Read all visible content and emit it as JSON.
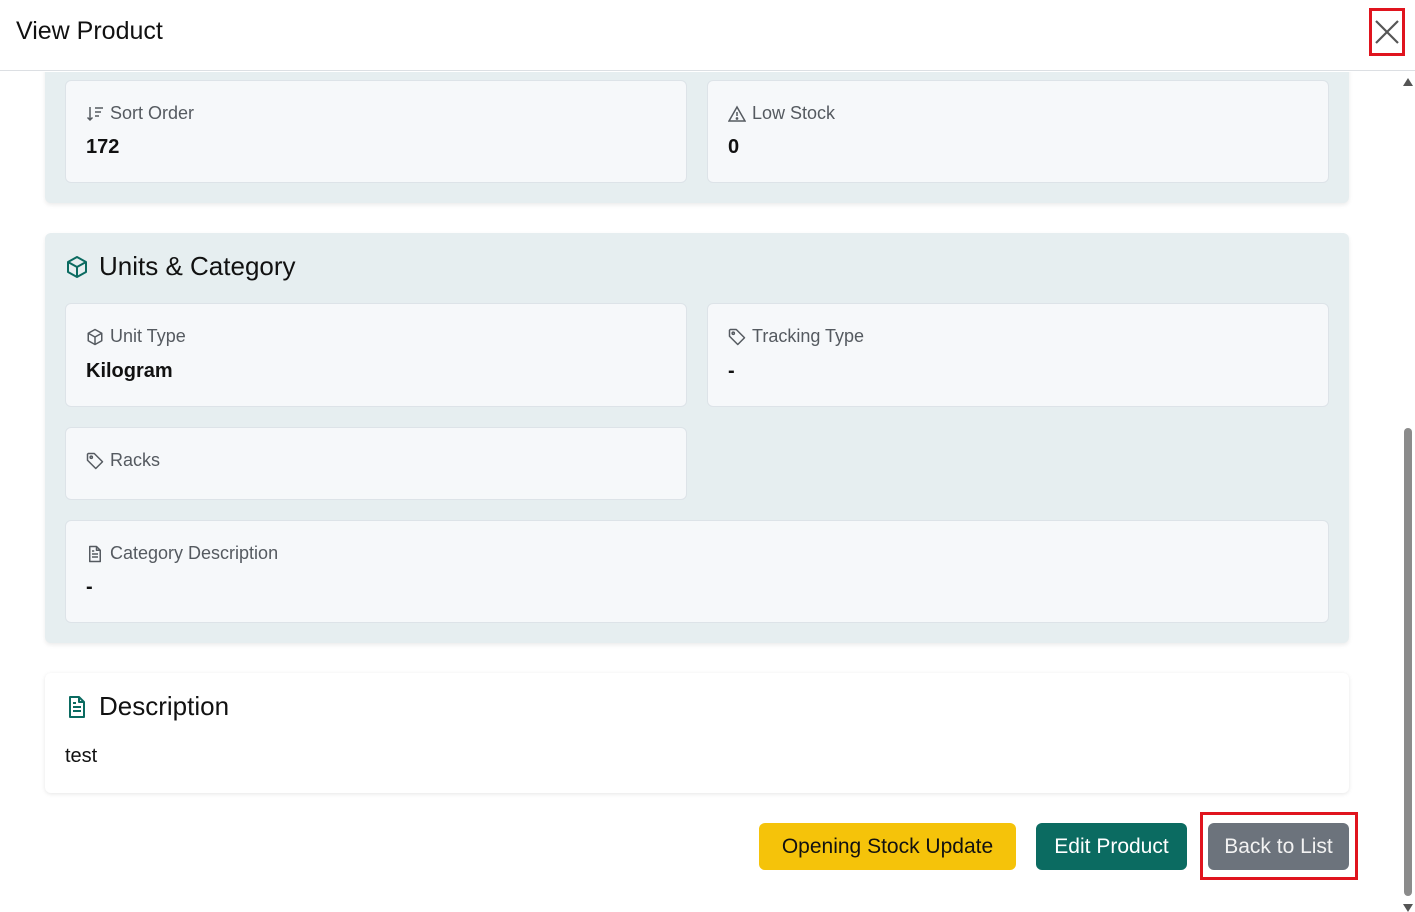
{
  "header": {
    "title": "View Product",
    "close_icon": "close-icon"
  },
  "top_section": {
    "fields": [
      {
        "label": "Sort Order",
        "value": "172",
        "icon": "sort-descending-icon"
      },
      {
        "label": "Low Stock",
        "value": "0",
        "icon": "warning-triangle-icon"
      }
    ]
  },
  "units_section": {
    "title": "Units & Category",
    "icon": "cube-icon",
    "fields": [
      {
        "label": "Unit Type",
        "value": "Kilogram",
        "icon": "cube-icon"
      },
      {
        "label": "Tracking Type",
        "value": "-",
        "icon": "tag-icon"
      },
      {
        "label": "Racks",
        "value": "",
        "icon": "tag-icon"
      },
      {
        "label": "Category Description",
        "value": "-",
        "icon": "document-icon"
      }
    ]
  },
  "description_section": {
    "title": "Description",
    "icon": "document-icon",
    "text": "test"
  },
  "actions": {
    "opening_stock_label": "Opening Stock Update",
    "edit_label": "Edit Product",
    "back_label": "Back to List"
  },
  "colors": {
    "accent_teal": "#0b6b61",
    "accent_yellow": "#f5c30a",
    "button_gray": "#6c737c",
    "panel_bg": "#e6eef0",
    "highlight_red": "#e0141e"
  }
}
